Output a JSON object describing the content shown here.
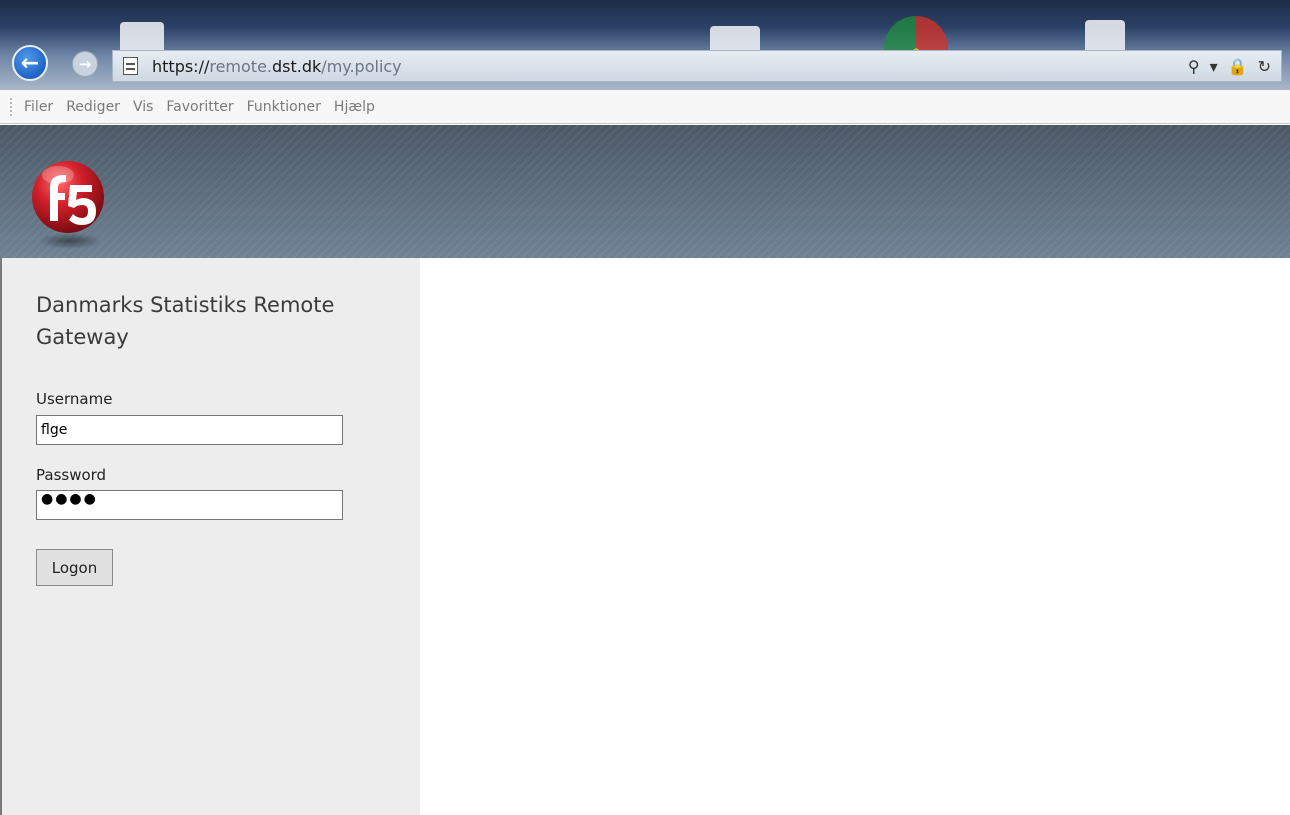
{
  "browser": {
    "url": {
      "scheme": "https://",
      "host_prefix": "remote.",
      "host_domain": "dst.dk",
      "path": "/my.policy"
    },
    "tools": {
      "search_icon": "⚲",
      "dropdown_icon": "▾",
      "lock_icon": "🔒",
      "refresh_icon": "↻"
    },
    "menu": [
      "Filer",
      "Rediger",
      "Vis",
      "Favoritter",
      "Funktioner",
      "Hjælp"
    ]
  },
  "login": {
    "title": "Danmarks Statistiks Remote Gateway",
    "username_label": "Username",
    "username_value": "flge",
    "password_label": "Password",
    "password_masked": "●●●●",
    "logon_label": "Logon"
  },
  "colors": {
    "brand_red": "#d21f2a",
    "header_gray": "#5f6f80",
    "panel_bg": "#ededed"
  }
}
